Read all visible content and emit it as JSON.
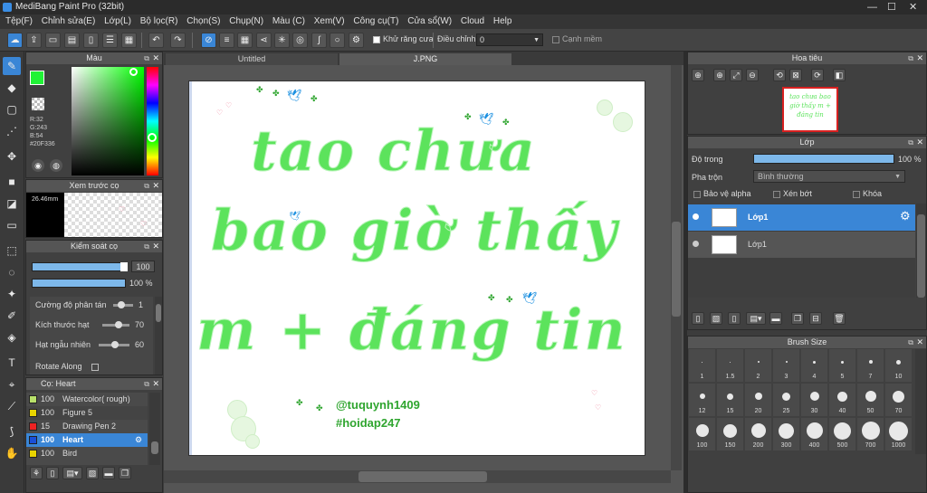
{
  "window": {
    "title": "MediBang Paint Pro (32bit)",
    "controls": [
      "—",
      "☐",
      "✕"
    ]
  },
  "menu": [
    "Tệp(F)",
    "Chỉnh sửa(E)",
    "Lớp(L)",
    "Bộ lọc(R)",
    "Chọn(S)",
    "Chụp(N)",
    "Màu (C)",
    "Xem(V)",
    "Công cụ(T)",
    "Cửa sổ(W)",
    "Cloud",
    "Help"
  ],
  "toolbar": {
    "antialias_label": "Khử răng cưa",
    "adjust_label": "Điều chỉnh",
    "adjust_value": "0",
    "sharp_label": "Cạnh mềm"
  },
  "color_panel": {
    "title": "Màu",
    "r": "R:32",
    "g": "G:243",
    "b": "B:54",
    "hex": "#20F336",
    "fg": "#20f336"
  },
  "preview_panel": {
    "title": "Xem trước cọ",
    "size": "26.46mm"
  },
  "brush_control": {
    "title": "Kiểm soát cọ",
    "size_value": "100",
    "opacity_value": "100 %",
    "params": [
      {
        "label": "Cường độ phân tán",
        "value": "1"
      },
      {
        "label": "Kích thước hạt",
        "value": "70"
      },
      {
        "label": "Hạt ngẫu nhiên",
        "value": "60"
      },
      {
        "label": "Rotate Along",
        "value": ""
      }
    ]
  },
  "brush_list": {
    "title": "Cọ: Heart",
    "items": [
      {
        "size": "100",
        "name": "Watercolor( rough)",
        "color": "#b8e06a",
        "selected": false
      },
      {
        "size": "100",
        "name": "Figure 5",
        "color": "#e8d400",
        "selected": false
      },
      {
        "size": "15",
        "name": "Drawing Pen 2",
        "color": "#e22",
        "selected": false
      },
      {
        "size": "100",
        "name": "Heart",
        "color": "#1a4fd8",
        "selected": true
      },
      {
        "size": "100",
        "name": "Bird",
        "color": "#e8d400",
        "selected": false
      }
    ]
  },
  "tabs": [
    {
      "label": "Untitled",
      "active": false
    },
    {
      "label": "J.PNG",
      "active": true
    }
  ],
  "artwork": {
    "line1": "tao chưa",
    "line2": "bao giờ thấy",
    "line3": "m + đáng tin",
    "signature1": "@tuquynh1409",
    "signature2": "#hoidap247"
  },
  "navigator": {
    "title": "Hoa tiêu",
    "thumb_text": "tao chưa bao giờ thấy m + đáng tin"
  },
  "layer_panel": {
    "title": "Lớp",
    "opacity_label": "Độ trong",
    "opacity_value": "100 %",
    "opacity_fraction": 1.0,
    "blend_label": "Pha trộn",
    "blend_value": "Bình thường",
    "protect_alpha": "Bảo vệ alpha",
    "clipping": "Xén bớt",
    "lock": "Khóa",
    "layers": [
      {
        "name": "Lớp1",
        "selected": true
      },
      {
        "name": "Lớp1",
        "selected": false
      }
    ]
  },
  "brush_size": {
    "title": "Brush Size",
    "sizes": [
      "1",
      "1.5",
      "2",
      "3",
      "4",
      "5",
      "7",
      "10",
      "12",
      "15",
      "20",
      "25",
      "30",
      "40",
      "50",
      "70",
      "100",
      "150",
      "200",
      "300",
      "400",
      "500",
      "700",
      "1000"
    ]
  }
}
